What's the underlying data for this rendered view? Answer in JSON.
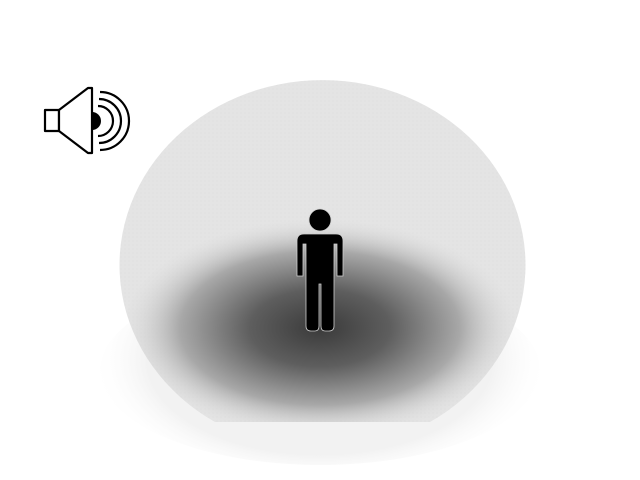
{
  "scene": {
    "background": "#ffffff",
    "sphere_color": "#e3e3e3",
    "shadow_color": "#3a3a3a",
    "figure_color": "#000000"
  },
  "icons": {
    "speaker": "speaker-icon",
    "person": "person-icon"
  }
}
